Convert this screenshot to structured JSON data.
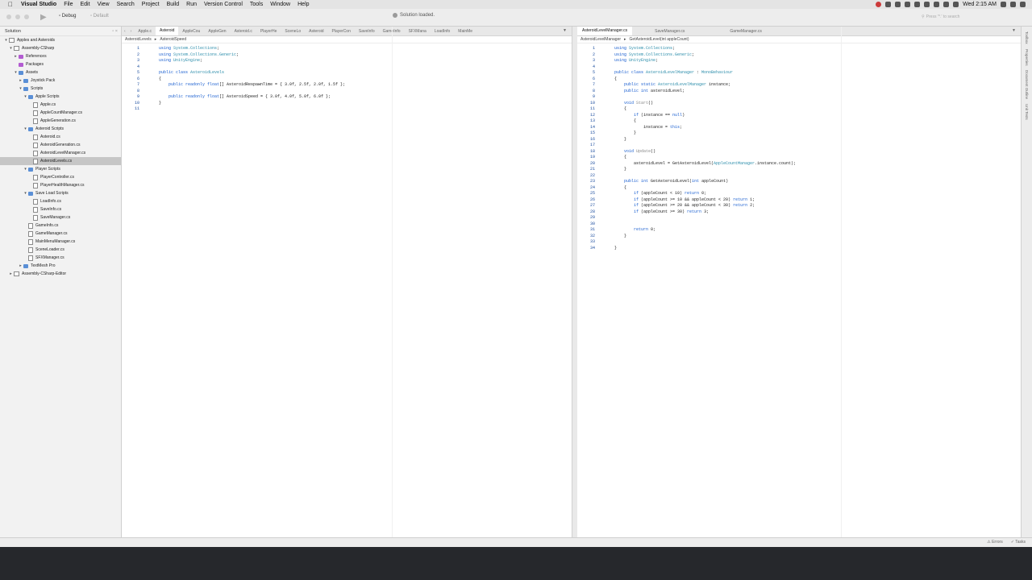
{
  "menubar": {
    "app_name": "Visual Studio",
    "items": [
      "File",
      "Edit",
      "View",
      "Search",
      "Project",
      "Build",
      "Run",
      "Version Control",
      "Tools",
      "Window",
      "Help"
    ],
    "clock": "Wed 2:15 AM"
  },
  "toolbar": {
    "configuration": "Debug",
    "target": "Default",
    "status": "Solution loaded.",
    "search_placeholder": "Press '^.' to search"
  },
  "sidebar": {
    "title": "Solution",
    "tree": [
      {
        "label": "Apples and Asteroids",
        "depth": 0,
        "icon": "proj",
        "tri": "▾"
      },
      {
        "label": "Assembly-CSharp",
        "depth": 1,
        "icon": "proj",
        "tri": "▾"
      },
      {
        "label": "References",
        "depth": 2,
        "icon": "ref",
        "tri": "▸"
      },
      {
        "label": "Packages",
        "depth": 2,
        "icon": "ref",
        "tri": ""
      },
      {
        "label": "Assets",
        "depth": 2,
        "icon": "folder",
        "tri": "▾"
      },
      {
        "label": "Joystick Pack",
        "depth": 3,
        "icon": "folder",
        "tri": "▸"
      },
      {
        "label": "Scripts",
        "depth": 3,
        "icon": "folder",
        "tri": "▾"
      },
      {
        "label": "Apple Scripts",
        "depth": 4,
        "icon": "folder",
        "tri": "▾"
      },
      {
        "label": "Apple.cs",
        "depth": 5,
        "icon": "file",
        "tri": ""
      },
      {
        "label": "AppleCountManager.cs",
        "depth": 5,
        "icon": "file",
        "tri": ""
      },
      {
        "label": "AppleGeneration.cs",
        "depth": 5,
        "icon": "file",
        "tri": ""
      },
      {
        "label": "Asteroid Scripts",
        "depth": 4,
        "icon": "folder",
        "tri": "▾"
      },
      {
        "label": "Asteroid.cs",
        "depth": 5,
        "icon": "file",
        "tri": ""
      },
      {
        "label": "AsteroidGeneration.cs",
        "depth": 5,
        "icon": "file",
        "tri": ""
      },
      {
        "label": "AsteroidLevelManager.cs",
        "depth": 5,
        "icon": "file",
        "tri": ""
      },
      {
        "label": "AsteroidLevels.cs",
        "depth": 5,
        "icon": "file",
        "tri": "",
        "selected": true
      },
      {
        "label": "Player Scripts",
        "depth": 4,
        "icon": "folder",
        "tri": "▾"
      },
      {
        "label": "PlayerController.cs",
        "depth": 5,
        "icon": "file",
        "tri": ""
      },
      {
        "label": "PlayerHealthManager.cs",
        "depth": 5,
        "icon": "file",
        "tri": ""
      },
      {
        "label": "Save Load Scripts",
        "depth": 4,
        "icon": "folder",
        "tri": "▾"
      },
      {
        "label": "LoadInfo.cs",
        "depth": 5,
        "icon": "file",
        "tri": ""
      },
      {
        "label": "SaveInfo.cs",
        "depth": 5,
        "icon": "file",
        "tri": ""
      },
      {
        "label": "SaveManager.cs",
        "depth": 5,
        "icon": "file",
        "tri": ""
      },
      {
        "label": "GameInfo.cs",
        "depth": 4,
        "icon": "file",
        "tri": ""
      },
      {
        "label": "GameManager.cs",
        "depth": 4,
        "icon": "file",
        "tri": ""
      },
      {
        "label": "MainMenuManager.cs",
        "depth": 4,
        "icon": "file",
        "tri": ""
      },
      {
        "label": "SceneLoader.cs",
        "depth": 4,
        "icon": "file",
        "tri": ""
      },
      {
        "label": "SFXManager.cs",
        "depth": 4,
        "icon": "file",
        "tri": ""
      },
      {
        "label": "TextMesh Pro",
        "depth": 3,
        "icon": "folder",
        "tri": "▸"
      },
      {
        "label": "Assembly-CSharp-Editor",
        "depth": 1,
        "icon": "proj",
        "tri": "▸"
      }
    ]
  },
  "left_editor": {
    "tabs": [
      "Apple.c",
      "Asteroid",
      "AppleCou",
      "AppleGen",
      "Asteroid.c",
      "PlayerHe",
      "SceneLo",
      "Asteroid",
      "PlayerCon",
      "SaveInfo",
      "GameInfo",
      "SFXMana",
      "LoadInfo",
      "MainMe"
    ],
    "active_tab": 1,
    "breadcrumb": [
      "AsteroidLevels",
      "AsteroidSpeed"
    ],
    "lines": [
      [
        [
          "kw",
          "using "
        ],
        [
          "ty",
          "System.Collections"
        ],
        [
          "ct",
          ";"
        ]
      ],
      [
        [
          "kw",
          "using "
        ],
        [
          "ty",
          "System.Collections.Generic"
        ],
        [
          "ct",
          ";"
        ]
      ],
      [
        [
          "kw",
          "using "
        ],
        [
          "ty",
          "UnityEngine"
        ],
        [
          "ct",
          ";"
        ]
      ],
      [],
      [
        [
          "kw",
          "public class "
        ],
        [
          "ty",
          "AsteroidLevels"
        ]
      ],
      [
        [
          "ct",
          "{"
        ]
      ],
      [
        [
          "ct",
          "    "
        ],
        [
          "kw",
          "public readonly float"
        ],
        [
          "ct",
          "[] AsteroidRespawnTime = { 3.0f, 2.5f, 2.0f, 1.5f };"
        ]
      ],
      [],
      [
        [
          "ct",
          "    "
        ],
        [
          "kw",
          "public readonly float"
        ],
        [
          "ct",
          "[] AsteroidSpeed = { 3.0f, 4.0f, 5.0f, 6.0f };"
        ]
      ],
      [
        [
          "ct",
          "}"
        ]
      ],
      []
    ]
  },
  "right_editor": {
    "tabs": [
      "AsteroidLevelManager.cs",
      "SaveManager.cs",
      "GameManager.cs"
    ],
    "active_tab": 0,
    "breadcrumb": [
      "AsteroidLevelManager",
      "GetAsteroidLevel(int appleCount)"
    ],
    "lines": [
      [
        [
          "kw",
          "using "
        ],
        [
          "ty",
          "System.Collections"
        ],
        [
          "ct",
          ";"
        ]
      ],
      [
        [
          "kw",
          "using "
        ],
        [
          "ty",
          "System.Collections.Generic"
        ],
        [
          "ct",
          ";"
        ]
      ],
      [
        [
          "kw",
          "using "
        ],
        [
          "ty",
          "UnityEngine"
        ],
        [
          "ct",
          ";"
        ]
      ],
      [],
      [
        [
          "kw",
          "public class "
        ],
        [
          "ty",
          "AsteroidLevelManager"
        ],
        [
          "ct",
          " : "
        ],
        [
          "ty",
          "MonoBehaviour"
        ]
      ],
      [
        [
          "ct",
          "{"
        ]
      ],
      [
        [
          "ct",
          "    "
        ],
        [
          "kw",
          "public static "
        ],
        [
          "ty",
          "AsteroidLevelManager"
        ],
        [
          "ct",
          " instance;"
        ]
      ],
      [
        [
          "ct",
          "    "
        ],
        [
          "kw",
          "public int "
        ],
        [
          "ct",
          "asteroidLevel;"
        ]
      ],
      [],
      [
        [
          "ct",
          "    "
        ],
        [
          "kw",
          "void "
        ],
        [
          "cm",
          "Start"
        ],
        [
          "ct",
          "()"
        ]
      ],
      [
        [
          "ct",
          "    {"
        ]
      ],
      [
        [
          "ct",
          "        "
        ],
        [
          "kw",
          "if "
        ],
        [
          "ct",
          "(instance == "
        ],
        [
          "kw",
          "null"
        ],
        [
          "ct",
          ")"
        ]
      ],
      [
        [
          "ct",
          "        {"
        ]
      ],
      [
        [
          "ct",
          "            instance = "
        ],
        [
          "kw",
          "this"
        ],
        [
          "ct",
          ";"
        ]
      ],
      [
        [
          "ct",
          "        }"
        ]
      ],
      [
        [
          "ct",
          "    }"
        ]
      ],
      [],
      [
        [
          "ct",
          "    "
        ],
        [
          "kw",
          "void "
        ],
        [
          "cm",
          "Update"
        ],
        [
          "ct",
          "()"
        ]
      ],
      [
        [
          "ct",
          "    {"
        ]
      ],
      [
        [
          "ct",
          "        asteroidLevel = GetAsteroidLevel("
        ],
        [
          "ty",
          "AppleCountManager"
        ],
        [
          "ct",
          ".instance.count);"
        ]
      ],
      [
        [
          "ct",
          "    }"
        ]
      ],
      [],
      [
        [
          "ct",
          "    "
        ],
        [
          "kw",
          "public int "
        ],
        [
          "ct",
          "GetAsteroidLevel("
        ],
        [
          "kw",
          "int "
        ],
        [
          "ct",
          "appleCount)"
        ]
      ],
      [
        [
          "ct",
          "    {"
        ]
      ],
      [
        [
          "ct",
          "        "
        ],
        [
          "kw",
          "if "
        ],
        [
          "ct",
          "(appleCount < 10) "
        ],
        [
          "kw",
          "return "
        ],
        [
          "ct",
          "0;"
        ]
      ],
      [
        [
          "ct",
          "        "
        ],
        [
          "kw",
          "if "
        ],
        [
          "ct",
          "(appleCount >= 10 && appleCount < 20) "
        ],
        [
          "kw",
          "return "
        ],
        [
          "ct",
          "1;"
        ]
      ],
      [
        [
          "ct",
          "        "
        ],
        [
          "kw",
          "if "
        ],
        [
          "ct",
          "(appleCount >= 20 && appleCount < 30) "
        ],
        [
          "kw",
          "return "
        ],
        [
          "ct",
          "2;"
        ]
      ],
      [
        [
          "ct",
          "        "
        ],
        [
          "kw",
          "if "
        ],
        [
          "ct",
          "(appleCount >= 30) "
        ],
        [
          "kw",
          "return "
        ],
        [
          "ct",
          "3;"
        ]
      ],
      [],
      [],
      [
        [
          "ct",
          "        "
        ],
        [
          "kw",
          "return "
        ],
        [
          "ct",
          "0;"
        ]
      ],
      [
        [
          "ct",
          "    }"
        ]
      ],
      [],
      [
        [
          "ct",
          "}"
        ]
      ]
    ]
  },
  "right_gutter": [
    "Toolbox",
    "Properties",
    "Document Outline",
    "Unit Tests"
  ],
  "bottombar": {
    "errors": "Errors",
    "tasks": "Tasks"
  }
}
